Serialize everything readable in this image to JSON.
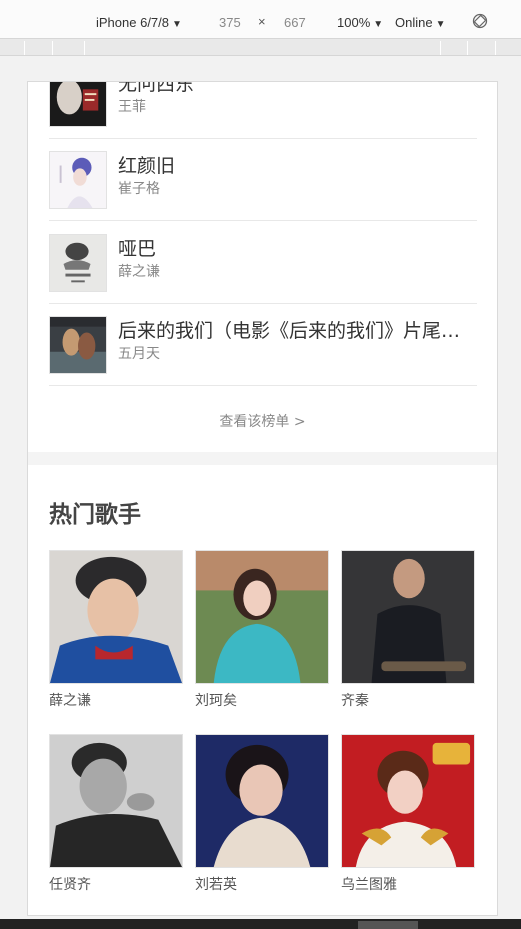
{
  "devtools": {
    "device": "iPhone 6/7/8",
    "width": "375",
    "times": "×",
    "height": "667",
    "zoom": "100%",
    "network": "Online",
    "arrow": "▼"
  },
  "songs": [
    {
      "title": "无问西东",
      "artist": "王菲"
    },
    {
      "title": "红颜旧",
      "artist": "崔子格"
    },
    {
      "title": "哑巴",
      "artist": "薛之谦"
    },
    {
      "title": "后来的我们（电影《后来的我们》片尾曲）",
      "artist": "五月天"
    }
  ],
  "more_link": "查看该榜单 >",
  "hot_singers": {
    "title": "热门歌手",
    "items": [
      {
        "name": "薛之谦"
      },
      {
        "name": "刘珂矣"
      },
      {
        "name": "齐秦"
      },
      {
        "name": "任贤齐"
      },
      {
        "name": "刘若英"
      },
      {
        "name": "乌兰图雅"
      }
    ]
  }
}
